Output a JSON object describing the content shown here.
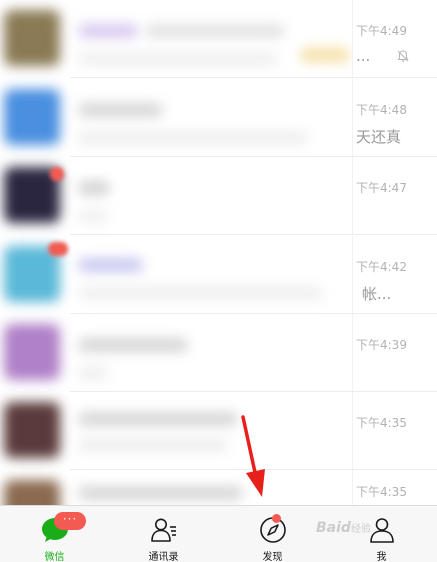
{
  "chats": [
    {
      "time": "下午4:49",
      "preview_tail": "...",
      "muted": true,
      "avatar_color": "#8a7a55",
      "accent": "#f0c060"
    },
    {
      "time": "下午4:48",
      "preview_tail": "天还真",
      "muted": false,
      "avatar_color": "#4a8fe0"
    },
    {
      "time": "下午4:47",
      "preview_tail": "",
      "muted": false,
      "avatar_color": "#2b2640"
    },
    {
      "time": "下午4:42",
      "preview_tail": "帐...",
      "muted": false,
      "avatar_color": "#5ab8d8"
    },
    {
      "time": "下午4:39",
      "preview_tail": "",
      "muted": false,
      "avatar_color": "#b080c8"
    },
    {
      "time": "下午4:35",
      "preview_tail": "",
      "muted": false,
      "avatar_color": "#5a3a3a"
    },
    {
      "time": "下午4:35",
      "preview_tail": "",
      "muted": false,
      "avatar_color": "#8a6a50"
    }
  ],
  "tabbar": {
    "tabs": [
      {
        "label": "微信",
        "icon": "chat-bubble-icon",
        "active": true,
        "badge": "···"
      },
      {
        "label": "通讯录",
        "icon": "contacts-icon",
        "active": false
      },
      {
        "label": "发现",
        "icon": "compass-icon",
        "active": false,
        "dot": true
      },
      {
        "label": "我",
        "icon": "person-icon",
        "active": false
      }
    ]
  },
  "watermark": {
    "text": "Baid",
    "suffix": "经验"
  },
  "colors": {
    "accent": "#1aad19",
    "badge": "#f25a52",
    "arrow": "#e8201c"
  }
}
